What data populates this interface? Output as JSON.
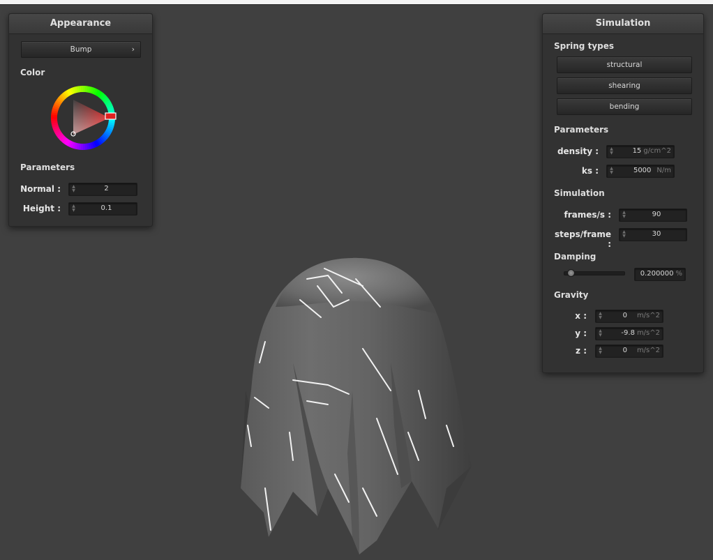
{
  "appearance": {
    "title": "Appearance",
    "shader_button": "Bump",
    "chevron": "›",
    "color_label": "Color",
    "parameters_label": "Parameters",
    "normal_label": "Normal :",
    "normal_value": "2",
    "height_label": "Height :",
    "height_value": "0.1",
    "selected_hue": "#e02020"
  },
  "simulation": {
    "title": "Simulation",
    "spring_types_label": "Spring types",
    "spring_types": [
      "structural",
      "shearing",
      "bending"
    ],
    "parameters_label": "Parameters",
    "density_label": "density :",
    "density_value": "15",
    "density_unit": "g/cm^2",
    "ks_label": "ks :",
    "ks_value": "5000",
    "ks_unit": "N/m",
    "simulation_label": "Simulation",
    "fps_label": "frames/s :",
    "fps_value": "90",
    "steps_label": "steps/frame :",
    "steps_value": "30",
    "damping_label": "Damping",
    "damping_value": "0.200000",
    "damping_unit": "%",
    "damping_fraction": 0.2,
    "gravity_label": "Gravity",
    "gx_label": "x :",
    "gx_value": "0",
    "gy_label": "y :",
    "gy_value": "-9.8",
    "gz_label": "z :",
    "gz_value": "0",
    "gravity_unit": "m/s^2"
  },
  "scene": {
    "background_color": "#404040",
    "object": "cloth-draped-over-sphere"
  }
}
